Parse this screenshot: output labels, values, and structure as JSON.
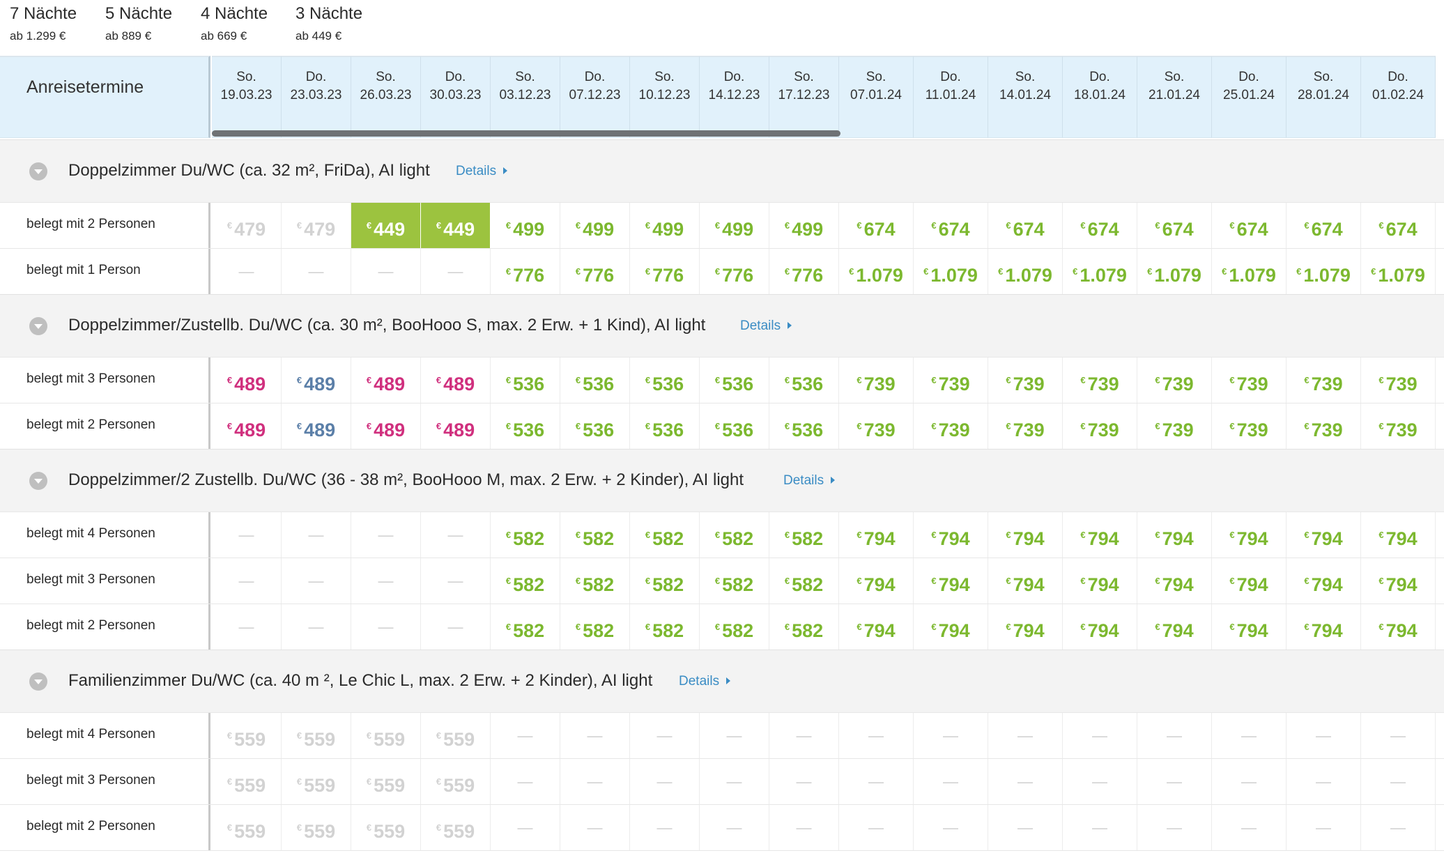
{
  "tabs": [
    {
      "title": "7 Nächte",
      "sub": "ab 1.299 €",
      "active": false
    },
    {
      "title": "5 Nächte",
      "sub": "ab 889 €",
      "active": false
    },
    {
      "title": "4 Nächte",
      "sub": "ab 669 €",
      "active": false
    },
    {
      "title": "3 Nächte",
      "sub": "ab 449 €",
      "active": true
    }
  ],
  "header_label": "Anreisetermine",
  "currency_symbol": "€",
  "dates": [
    {
      "day": "So.",
      "date": "19.03.23"
    },
    {
      "day": "Do.",
      "date": "23.03.23"
    },
    {
      "day": "So.",
      "date": "26.03.23"
    },
    {
      "day": "Do.",
      "date": "30.03.23"
    },
    {
      "day": "So.",
      "date": "03.12.23"
    },
    {
      "day": "Do.",
      "date": "07.12.23"
    },
    {
      "day": "So.",
      "date": "10.12.23"
    },
    {
      "day": "Do.",
      "date": "14.12.23"
    },
    {
      "day": "So.",
      "date": "17.12.23"
    },
    {
      "day": "So.",
      "date": "07.01.24"
    },
    {
      "day": "Do.",
      "date": "11.01.24"
    },
    {
      "day": "So.",
      "date": "14.01.24"
    },
    {
      "day": "Do.",
      "date": "18.01.24"
    },
    {
      "day": "So.",
      "date": "21.01.24"
    },
    {
      "day": "Do.",
      "date": "25.01.24"
    },
    {
      "day": "So.",
      "date": "28.01.24"
    },
    {
      "day": "Do.",
      "date": "01.02.24"
    }
  ],
  "colors": {
    "green": "#7cb82f",
    "highlight": "#9cc33f",
    "pink": "#d0307e",
    "blue": "#5b7fa8",
    "unavailable": "#d2d2d2",
    "link": "#3a8cc4",
    "tab_underline": "#e9be3c"
  },
  "groups": [
    {
      "name": "Doppelzimmer Du/WC (ca. 32 m², FriDa), AI light",
      "details": "Details",
      "rows": [
        {
          "label": "belegt mit 2 Personen",
          "cells": [
            {
              "v": "479",
              "s": "grey"
            },
            {
              "v": "479",
              "s": "grey"
            },
            {
              "v": "449",
              "s": "hl"
            },
            {
              "v": "449",
              "s": "hl"
            },
            {
              "v": "499",
              "s": "green"
            },
            {
              "v": "499",
              "s": "green"
            },
            {
              "v": "499",
              "s": "green"
            },
            {
              "v": "499",
              "s": "green"
            },
            {
              "v": "499",
              "s": "green"
            },
            {
              "v": "674",
              "s": "green"
            },
            {
              "v": "674",
              "s": "green"
            },
            {
              "v": "674",
              "s": "green"
            },
            {
              "v": "674",
              "s": "green"
            },
            {
              "v": "674",
              "s": "green"
            },
            {
              "v": "674",
              "s": "green"
            },
            {
              "v": "674",
              "s": "green"
            },
            {
              "v": "674",
              "s": "green"
            }
          ]
        },
        {
          "label": "belegt mit 1 Person",
          "cells": [
            {
              "v": "",
              "s": "dash"
            },
            {
              "v": "",
              "s": "dash"
            },
            {
              "v": "",
              "s": "dash"
            },
            {
              "v": "",
              "s": "dash"
            },
            {
              "v": "776",
              "s": "green"
            },
            {
              "v": "776",
              "s": "green"
            },
            {
              "v": "776",
              "s": "green"
            },
            {
              "v": "776",
              "s": "green"
            },
            {
              "v": "776",
              "s": "green"
            },
            {
              "v": "1.079",
              "s": "green"
            },
            {
              "v": "1.079",
              "s": "green"
            },
            {
              "v": "1.079",
              "s": "green"
            },
            {
              "v": "1.079",
              "s": "green"
            },
            {
              "v": "1.079",
              "s": "green"
            },
            {
              "v": "1.079",
              "s": "green"
            },
            {
              "v": "1.079",
              "s": "green"
            },
            {
              "v": "1.079",
              "s": "green"
            }
          ]
        }
      ]
    },
    {
      "name": "Doppelzimmer/Zustellb. Du/WC (ca. 30 m², BooHooo S, max. 2 Erw. + 1 Kind), AI light",
      "details": "Details",
      "rows": [
        {
          "label": "belegt mit 3 Personen",
          "cells": [
            {
              "v": "489",
              "s": "pink"
            },
            {
              "v": "489",
              "s": "blue"
            },
            {
              "v": "489",
              "s": "pink"
            },
            {
              "v": "489",
              "s": "pink"
            },
            {
              "v": "536",
              "s": "green"
            },
            {
              "v": "536",
              "s": "green"
            },
            {
              "v": "536",
              "s": "green"
            },
            {
              "v": "536",
              "s": "green"
            },
            {
              "v": "536",
              "s": "green"
            },
            {
              "v": "739",
              "s": "green"
            },
            {
              "v": "739",
              "s": "green"
            },
            {
              "v": "739",
              "s": "green"
            },
            {
              "v": "739",
              "s": "green"
            },
            {
              "v": "739",
              "s": "green"
            },
            {
              "v": "739",
              "s": "green"
            },
            {
              "v": "739",
              "s": "green"
            },
            {
              "v": "739",
              "s": "green"
            }
          ]
        },
        {
          "label": "belegt mit 2 Personen",
          "cells": [
            {
              "v": "489",
              "s": "pink"
            },
            {
              "v": "489",
              "s": "blue"
            },
            {
              "v": "489",
              "s": "pink"
            },
            {
              "v": "489",
              "s": "pink"
            },
            {
              "v": "536",
              "s": "green"
            },
            {
              "v": "536",
              "s": "green"
            },
            {
              "v": "536",
              "s": "green"
            },
            {
              "v": "536",
              "s": "green"
            },
            {
              "v": "536",
              "s": "green"
            },
            {
              "v": "739",
              "s": "green"
            },
            {
              "v": "739",
              "s": "green"
            },
            {
              "v": "739",
              "s": "green"
            },
            {
              "v": "739",
              "s": "green"
            },
            {
              "v": "739",
              "s": "green"
            },
            {
              "v": "739",
              "s": "green"
            },
            {
              "v": "739",
              "s": "green"
            },
            {
              "v": "739",
              "s": "green"
            }
          ]
        }
      ]
    },
    {
      "name": "Doppelzimmer/2 Zustellb. Du/WC (36 - 38 m², BooHooo M, max. 2 Erw. + 2 Kinder), AI light",
      "details": "Details",
      "rows": [
        {
          "label": "belegt mit 4 Personen",
          "cells": [
            {
              "v": "",
              "s": "dash"
            },
            {
              "v": "",
              "s": "dash"
            },
            {
              "v": "",
              "s": "dash"
            },
            {
              "v": "",
              "s": "dash"
            },
            {
              "v": "582",
              "s": "green"
            },
            {
              "v": "582",
              "s": "green"
            },
            {
              "v": "582",
              "s": "green"
            },
            {
              "v": "582",
              "s": "green"
            },
            {
              "v": "582",
              "s": "green"
            },
            {
              "v": "794",
              "s": "green"
            },
            {
              "v": "794",
              "s": "green"
            },
            {
              "v": "794",
              "s": "green"
            },
            {
              "v": "794",
              "s": "green"
            },
            {
              "v": "794",
              "s": "green"
            },
            {
              "v": "794",
              "s": "green"
            },
            {
              "v": "794",
              "s": "green"
            },
            {
              "v": "794",
              "s": "green"
            }
          ]
        },
        {
          "label": "belegt mit 3 Personen",
          "cells": [
            {
              "v": "",
              "s": "dash"
            },
            {
              "v": "",
              "s": "dash"
            },
            {
              "v": "",
              "s": "dash"
            },
            {
              "v": "",
              "s": "dash"
            },
            {
              "v": "582",
              "s": "green"
            },
            {
              "v": "582",
              "s": "green"
            },
            {
              "v": "582",
              "s": "green"
            },
            {
              "v": "582",
              "s": "green"
            },
            {
              "v": "582",
              "s": "green"
            },
            {
              "v": "794",
              "s": "green"
            },
            {
              "v": "794",
              "s": "green"
            },
            {
              "v": "794",
              "s": "green"
            },
            {
              "v": "794",
              "s": "green"
            },
            {
              "v": "794",
              "s": "green"
            },
            {
              "v": "794",
              "s": "green"
            },
            {
              "v": "794",
              "s": "green"
            },
            {
              "v": "794",
              "s": "green"
            }
          ]
        },
        {
          "label": "belegt mit 2 Personen",
          "cells": [
            {
              "v": "",
              "s": "dash"
            },
            {
              "v": "",
              "s": "dash"
            },
            {
              "v": "",
              "s": "dash"
            },
            {
              "v": "",
              "s": "dash"
            },
            {
              "v": "582",
              "s": "green"
            },
            {
              "v": "582",
              "s": "green"
            },
            {
              "v": "582",
              "s": "green"
            },
            {
              "v": "582",
              "s": "green"
            },
            {
              "v": "582",
              "s": "green"
            },
            {
              "v": "794",
              "s": "green"
            },
            {
              "v": "794",
              "s": "green"
            },
            {
              "v": "794",
              "s": "green"
            },
            {
              "v": "794",
              "s": "green"
            },
            {
              "v": "794",
              "s": "green"
            },
            {
              "v": "794",
              "s": "green"
            },
            {
              "v": "794",
              "s": "green"
            },
            {
              "v": "794",
              "s": "green"
            }
          ]
        }
      ]
    },
    {
      "name": "Familienzimmer Du/WC (ca. 40 m ², Le Chic L, max. 2 Erw. + 2 Kinder), AI light",
      "details": "Details",
      "rows": [
        {
          "label": "belegt mit 4 Personen",
          "cells": [
            {
              "v": "559",
              "s": "grey"
            },
            {
              "v": "559",
              "s": "grey"
            },
            {
              "v": "559",
              "s": "grey"
            },
            {
              "v": "559",
              "s": "grey"
            },
            {
              "v": "",
              "s": "dash"
            },
            {
              "v": "",
              "s": "dash"
            },
            {
              "v": "",
              "s": "dash"
            },
            {
              "v": "",
              "s": "dash"
            },
            {
              "v": "",
              "s": "dash"
            },
            {
              "v": "",
              "s": "dash"
            },
            {
              "v": "",
              "s": "dash"
            },
            {
              "v": "",
              "s": "dash"
            },
            {
              "v": "",
              "s": "dash"
            },
            {
              "v": "",
              "s": "dash"
            },
            {
              "v": "",
              "s": "dash"
            },
            {
              "v": "",
              "s": "dash"
            },
            {
              "v": "",
              "s": "dash"
            }
          ]
        },
        {
          "label": "belegt mit 3 Personen",
          "cells": [
            {
              "v": "559",
              "s": "grey"
            },
            {
              "v": "559",
              "s": "grey"
            },
            {
              "v": "559",
              "s": "grey"
            },
            {
              "v": "559",
              "s": "grey"
            },
            {
              "v": "",
              "s": "dash"
            },
            {
              "v": "",
              "s": "dash"
            },
            {
              "v": "",
              "s": "dash"
            },
            {
              "v": "",
              "s": "dash"
            },
            {
              "v": "",
              "s": "dash"
            },
            {
              "v": "",
              "s": "dash"
            },
            {
              "v": "",
              "s": "dash"
            },
            {
              "v": "",
              "s": "dash"
            },
            {
              "v": "",
              "s": "dash"
            },
            {
              "v": "",
              "s": "dash"
            },
            {
              "v": "",
              "s": "dash"
            },
            {
              "v": "",
              "s": "dash"
            },
            {
              "v": "",
              "s": "dash"
            }
          ]
        },
        {
          "label": "belegt mit 2 Personen",
          "cells": [
            {
              "v": "559",
              "s": "grey"
            },
            {
              "v": "559",
              "s": "grey"
            },
            {
              "v": "559",
              "s": "grey"
            },
            {
              "v": "559",
              "s": "grey"
            },
            {
              "v": "",
              "s": "dash"
            },
            {
              "v": "",
              "s": "dash"
            },
            {
              "v": "",
              "s": "dash"
            },
            {
              "v": "",
              "s": "dash"
            },
            {
              "v": "",
              "s": "dash"
            },
            {
              "v": "",
              "s": "dash"
            },
            {
              "v": "",
              "s": "dash"
            },
            {
              "v": "",
              "s": "dash"
            },
            {
              "v": "",
              "s": "dash"
            },
            {
              "v": "",
              "s": "dash"
            },
            {
              "v": "",
              "s": "dash"
            },
            {
              "v": "",
              "s": "dash"
            },
            {
              "v": "",
              "s": "dash"
            }
          ]
        }
      ]
    }
  ]
}
